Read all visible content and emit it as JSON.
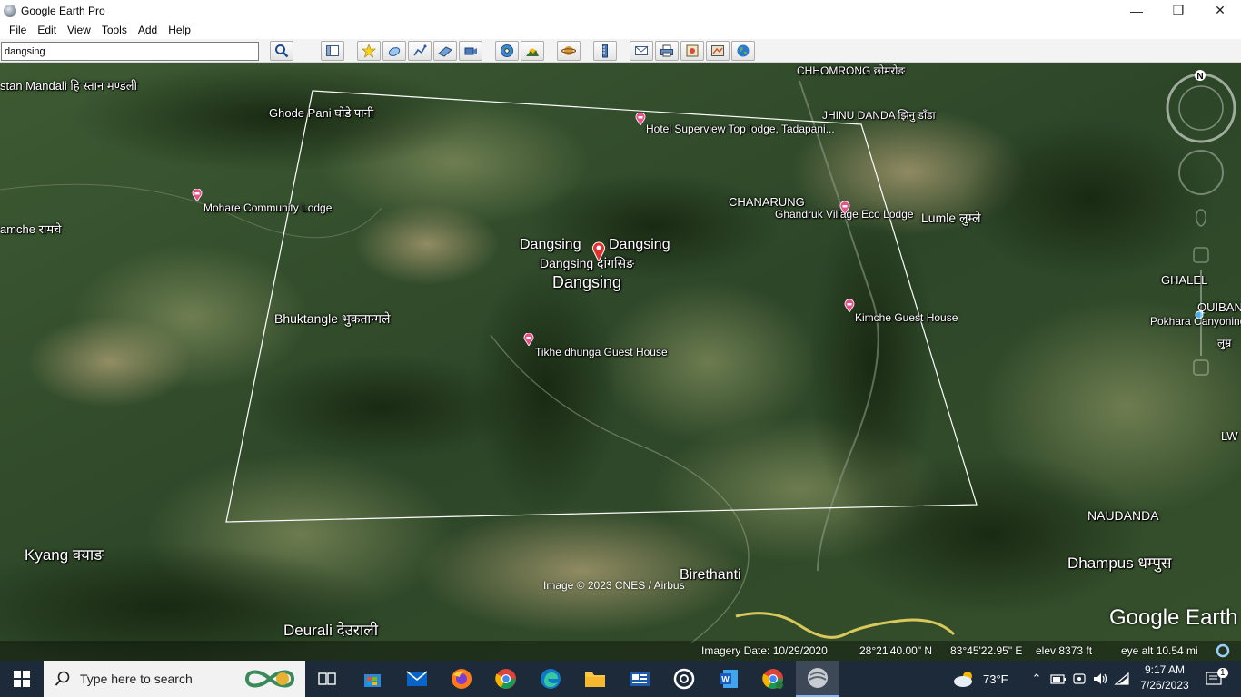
{
  "window": {
    "title": "Google Earth Pro",
    "controls": {
      "minimize": "—",
      "maximize": "❐",
      "close": "✕"
    }
  },
  "menu": [
    "File",
    "Edit",
    "View",
    "Tools",
    "Add",
    "Help"
  ],
  "search": {
    "value": "dangsing"
  },
  "toolbar": {
    "icons": [
      "search-icon",
      "sidebar-toggle-icon",
      "add-placemark-icon",
      "add-polygon-icon",
      "add-path-icon",
      "add-image-overlay-icon",
      "record-tour-icon",
      "historical-imagery-icon",
      "sunlight-icon",
      "planets-icon",
      "ruler-icon",
      "email-icon",
      "print-icon",
      "save-image-icon",
      "view-in-maps-icon",
      "earth-icon"
    ]
  },
  "map": {
    "labels": {
      "stan_mandali": "stan Mandali हि स्तान मण्डली",
      "chhomrong": "CHHOMRONG छोमरोङ",
      "ghode_pani": "Ghode Pani घोडे पानी",
      "jhinu_danda": "JHINU DANDA झिनु डाँडा",
      "hotel_superview": "Hotel Superview Top lodge, Tadapani...",
      "mohare": "Mohare Community Lodge",
      "amche": "amche रामचे",
      "chanarung": "CHANARUNG",
      "ghandruk": "Ghandruk Village Eco Lodge",
      "lumle": "Lumle लुम्ले",
      "dangsing_1": "Dangsing",
      "dangsing_2": "Dangsing",
      "dangsing_3": "Dangsing दांगसिङ",
      "dangsing_main": "Dangsing",
      "bhuktangle": "Bhuktangle भुकतान्गले",
      "kimche": "Kimche Guest House",
      "tikhe": "Tikhe dhunga Guest House",
      "ghalel": "GHALEL",
      "quiban": "QUIBAN",
      "pokhara": "Pokhara Canyoning",
      "lumre": "लुम्र",
      "lw": "LW",
      "naudanda": "NAUDANDA",
      "dhampus": "Dhampus धम्पुस",
      "kyang": "Kyang क्याङ",
      "birethanti": "Birethanti",
      "deurali": "Deurali देउराली"
    },
    "attribution": "Image © 2023 CNES / Airbus",
    "logo": "Google Earth",
    "compass_letter": "N"
  },
  "status": {
    "imagery_date": "Imagery Date: 10/29/2020",
    "lat": "28°21'40.00\" N",
    "lon": "83°45'22.95\" E",
    "elev": "elev  8373 ft",
    "eye_alt": "eye alt  10.54 mi"
  },
  "taskbar": {
    "search_placeholder": "Type here to search",
    "apps": [
      "task-view-icon",
      "store-icon",
      "mail-icon",
      "firefox-icon",
      "chrome-icon",
      "edge-icon",
      "file-explorer-icon",
      "news-icon",
      "obs-icon",
      "word-icon",
      "chrome-profile-icon",
      "google-earth-icon"
    ],
    "weather": "73°F",
    "time": "9:17 AM",
    "date": "7/26/2023",
    "notification_count": "1"
  }
}
